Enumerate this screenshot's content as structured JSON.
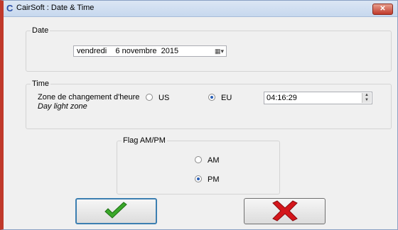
{
  "window": {
    "title": "CairSoft : Date & Time",
    "close_glyph": "✕"
  },
  "date_group": {
    "legend": "Date",
    "date_value": "vendredi    6 novembre  2015",
    "dropdown_glyph": "▦▾"
  },
  "time_group": {
    "legend": "Time",
    "zone_label": "Zone de changement d'heure",
    "zone_sublabel": "Day light zone",
    "options": [
      {
        "label": "US",
        "selected": false
      },
      {
        "label": "EU",
        "selected": true
      }
    ],
    "time_value": "04:16:29"
  },
  "flag_group": {
    "legend": "Flag AM/PM",
    "options": [
      {
        "label": "AM",
        "selected": false
      },
      {
        "label": "PM",
        "selected": true
      }
    ]
  },
  "buttons": {
    "ok_icon": "green-checkmark-icon",
    "cancel_icon": "red-x-icon"
  },
  "colors": {
    "ok": "#3aa82a",
    "cancel": "#d4161b",
    "accent": "#3c7fb1"
  }
}
